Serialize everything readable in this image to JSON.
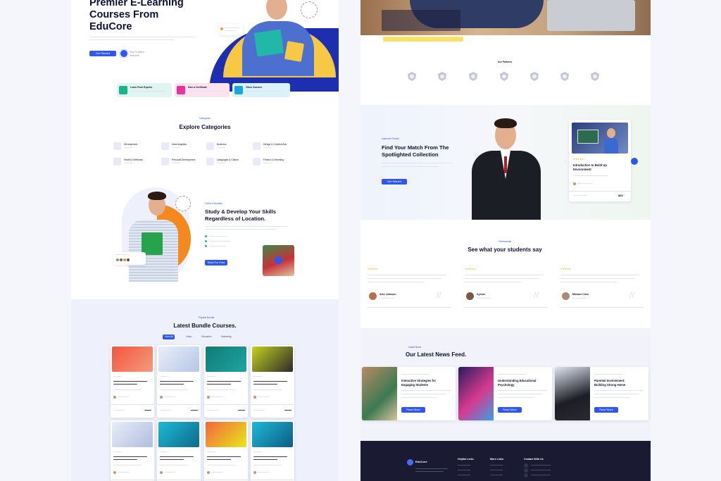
{
  "hero": {
    "title_l1": "Premier E-Learning",
    "title_l2": "Courses From",
    "title_l3": "EduCore",
    "btn": "Get Started",
    "play": "Play To Watch Welcome"
  },
  "features": [
    {
      "title": "Learn From Experts"
    },
    {
      "title": "Earn a Certificate"
    },
    {
      "title": "Video Courses"
    }
  ],
  "categories": {
    "tag": "Categories",
    "title": "Explore Categories",
    "items": [
      "Development",
      "Data Analytics",
      "Business",
      "Design & Creative Arts",
      "Health & Wellness",
      "Personal Development",
      "Languages & Culture",
      "Finance & Investing"
    ]
  },
  "study": {
    "tag": "Online Education",
    "title_l1": "Study & Develop Your Skills",
    "title_l2": "Regardless of Location.",
    "btn": "Start For Free"
  },
  "bundle": {
    "tag": "Popular Bundle",
    "title": "Latest Bundle Courses.",
    "tabs": [
      "View All",
      "Video",
      "Education",
      "Marketing"
    ]
  },
  "partners": {
    "title": "Our Partners"
  },
  "spotlight": {
    "tag": "Instructor Choice",
    "title_l1": "Find Your Match From The",
    "title_l2": "Spotlighted Collection",
    "btn": "Get Started",
    "course_title_l1": "Introduction to Build Up",
    "course_title_l2": "Environment",
    "price": "$60"
  },
  "testimonials": {
    "tag": "Testimonials",
    "title": "See what your students say",
    "items": [
      {
        "name": "Alex Johnson"
      },
      {
        "name": "Kyrene"
      },
      {
        "name": "Michael Chen"
      }
    ]
  },
  "news": {
    "tag": "Latest News",
    "title": "Our Latest News Feed.",
    "items": [
      {
        "title_l1": "Interactive Strategies for",
        "title_l2": "Engaging Students"
      },
      {
        "title_l1": "Understanding Educational",
        "title_l2": "Psychology"
      },
      {
        "title_l1": "Parental Involvement:",
        "title_l2": "Building Strong Home"
      }
    ],
    "btn": "Read More"
  },
  "footer": {
    "brand": "EduCore",
    "col1": "Helpful Links",
    "col2": "More Links",
    "col3": "Contact With Us"
  },
  "colors": {
    "accent": "#2f57ef",
    "dark": "#1a1b33",
    "yellow": "#f7c844",
    "bg_soft": "#f1f2fa"
  }
}
